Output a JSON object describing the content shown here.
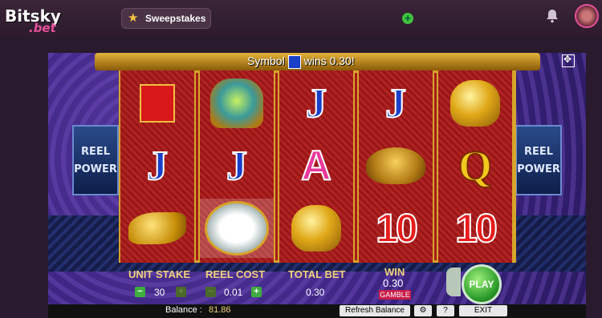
{
  "nav": {
    "logo_main": "Bitsky",
    "logo_sub": ".bet",
    "sweepstakes_label": "Sweepstakes",
    "plus_symbol": "+",
    "icons": [
      "star-icon",
      "bell-icon",
      "avatar"
    ]
  },
  "game": {
    "symbol_wins_prefix": "Symbol",
    "symbol_wins_suffix": "wins 0.30!",
    "reel_power_line1": "REEL",
    "reel_power_line2": "POWER",
    "reels": [
      [
        "envelope",
        "J",
        "fish"
      ],
      [
        "phoenix",
        "J",
        "plant"
      ],
      [
        "J",
        "A",
        "lion"
      ],
      [
        "J",
        "turtle",
        "10"
      ],
      [
        "lion",
        "Q",
        "10"
      ]
    ],
    "colors": {
      "accent_gold": "#d7a52a",
      "reel_red": "#a51c1c",
      "play_green": "#2a9a2a"
    }
  },
  "controls": {
    "unit_stake_label": "UNIT STAKE",
    "unit_stake_value": "30",
    "reel_cost_label": "REEL COST",
    "reel_cost_value": "0.01",
    "total_bet_label": "TOTAL BET",
    "total_bet_value": "0.30",
    "win_label": "WIN",
    "win_value": "0.30",
    "gamble_label": "GAMBLE",
    "play_label": "PLAY",
    "minus": "−",
    "plus": "+"
  },
  "bottom": {
    "balance_label": "Balance :",
    "balance_value": "81.86",
    "refresh_label": "Refresh Balance",
    "settings_icon": "⚙",
    "help_label": "?",
    "exit_label": "EXIT"
  }
}
